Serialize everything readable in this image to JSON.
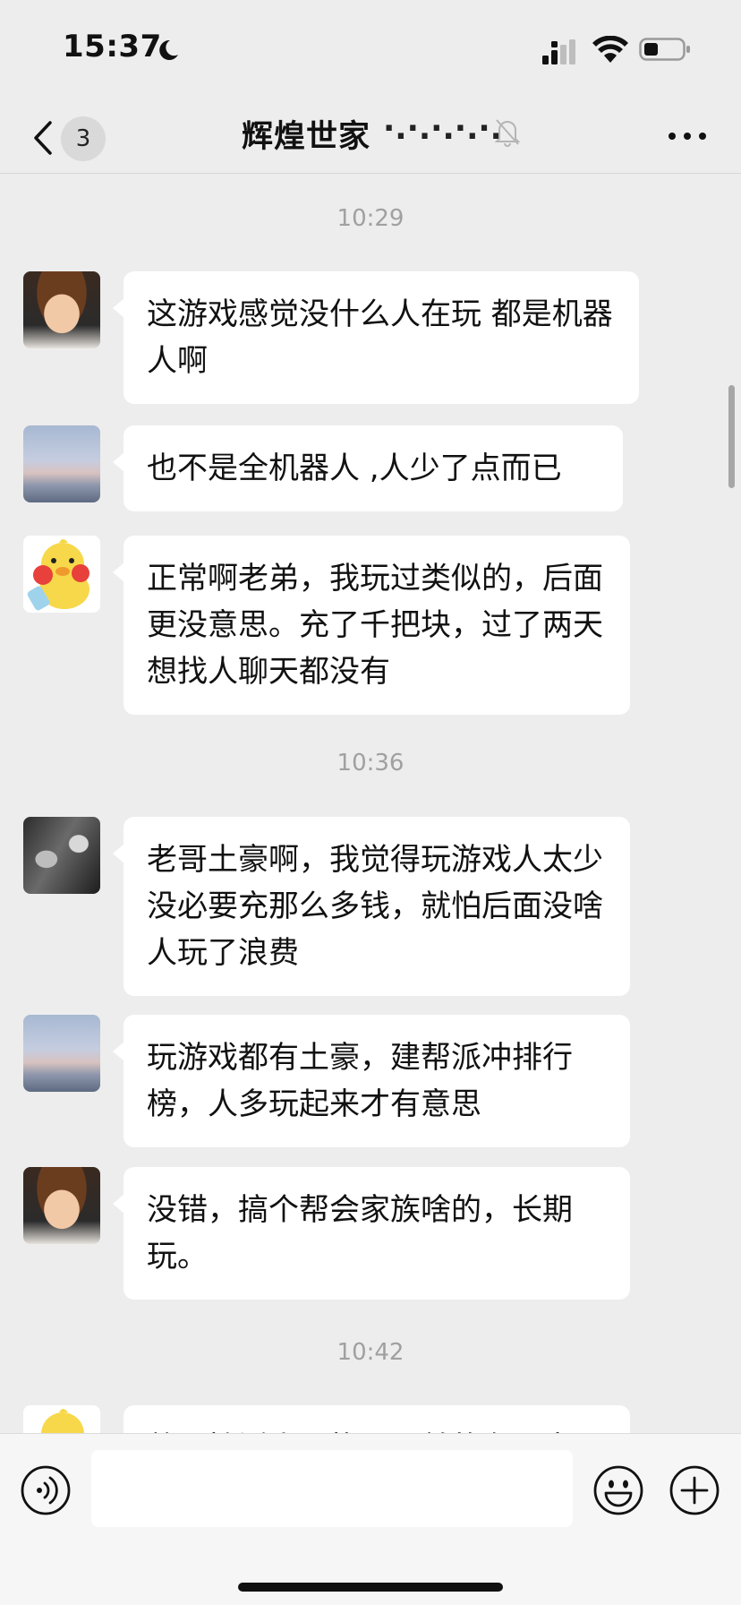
{
  "status_bar": {
    "time": "15:37",
    "icons": [
      "moon-icon",
      "signal-icon",
      "wifi-icon",
      "battery-icon"
    ]
  },
  "nav": {
    "back_badge": "3",
    "title": "辉煌世家",
    "title_suffix": "·.·.·.·.·.",
    "icons": [
      "back-chevron-icon",
      "mute-bell-icon",
      "more-icon"
    ]
  },
  "chat": {
    "timestamps": [
      "10:29",
      "10:36",
      "10:42"
    ],
    "messages": [
      {
        "avatar": "boy-photo",
        "text": "这游戏感觉没什么人在玩 都是机器人啊"
      },
      {
        "avatar": "sky-photo",
        "text": "也不是全机器人 ,人少了点而已"
      },
      {
        "avatar": "yellow-duck-cartoon",
        "text": "正常啊老弟，我玩过类似的，后面更没意思。充了千把块，过了两天想找人聊天都没有"
      },
      {
        "avatar": "black-white-photo",
        "text": "老哥土豪啊，我觉得玩游戏人太少没必要充那么多钱，就怕后面没啥人玩了浪费"
      },
      {
        "avatar": "sky-photo",
        "text": "玩游戏都有土豪，建帮派冲排行榜，人多玩起来才有意思"
      },
      {
        "avatar": "boy-photo",
        "text": "没错，搞个帮会家族啥的，长期玩。"
      },
      {
        "avatar": "yellow-duck-cartoon",
        "text": "整一拨活人一找玩一首的有目大"
      }
    ]
  },
  "input_bar": {
    "input_value": "",
    "icons": [
      "voice-icon",
      "emoji-icon",
      "plus-icon"
    ]
  }
}
